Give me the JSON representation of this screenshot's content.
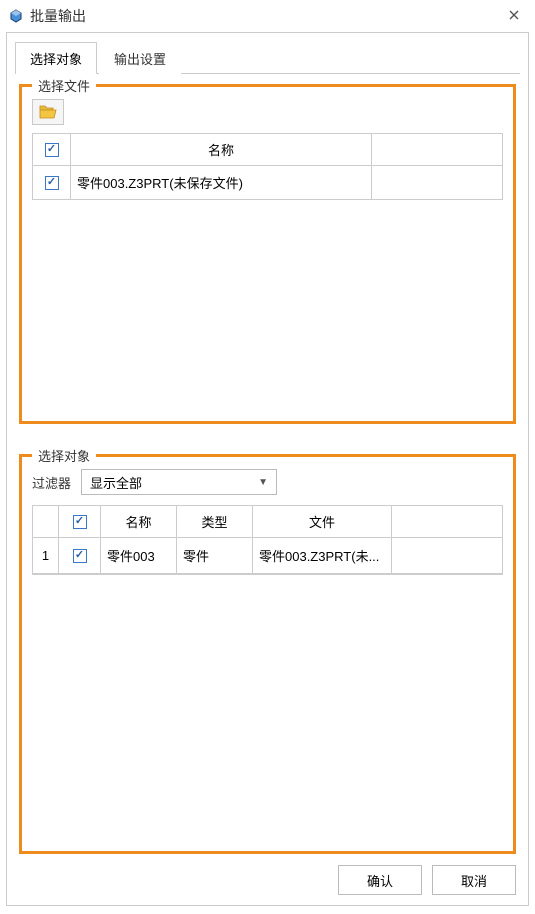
{
  "window": {
    "title": "批量输出"
  },
  "tabs": {
    "select_object": "选择对象",
    "output_settings": "输出设置"
  },
  "file_group": {
    "legend": "选择文件",
    "header_name": "名称",
    "rows": [
      {
        "name": "零件003.Z3PRT(未保存文件)"
      }
    ]
  },
  "object_group": {
    "legend": "选择对象",
    "filter_label": "过滤器",
    "filter_value": "显示全部",
    "header_name": "名称",
    "header_type": "类型",
    "header_file": "文件",
    "rows": [
      {
        "idx": "1",
        "name": "零件003",
        "type": "零件",
        "file": "零件003.Z3PRT(未..."
      }
    ]
  },
  "buttons": {
    "ok": "确认",
    "cancel": "取消"
  }
}
